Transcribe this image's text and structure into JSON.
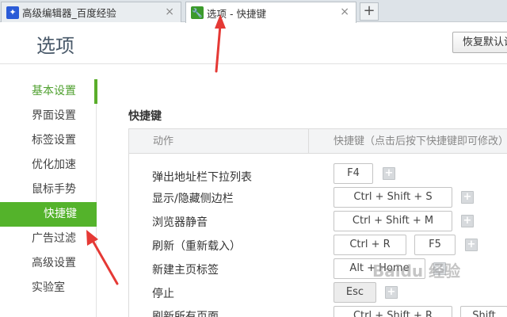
{
  "tabs": [
    {
      "label": "高级编辑器_百度经验",
      "close": "×",
      "icon": "paw-icon"
    },
    {
      "label": "选项 - 快捷键",
      "close": "×",
      "icon": "wrench-icon"
    }
  ],
  "new_tab_label": "+",
  "page": {
    "title": "选项",
    "restore_button": "恢复默认设置"
  },
  "sidebar": [
    {
      "label": "基本设置"
    },
    {
      "label": "界面设置"
    },
    {
      "label": "标签设置"
    },
    {
      "label": "优化加速"
    },
    {
      "label": "鼠标手势"
    },
    {
      "label": "快捷键"
    },
    {
      "label": "广告过滤"
    },
    {
      "label": "高级设置"
    },
    {
      "label": "实验室"
    }
  ],
  "section_title": "快捷键",
  "table": {
    "col_action": "动作",
    "col_shortcut": "快捷键（点击后按下快捷键即可修改）",
    "rows": [
      {
        "action": "弹出地址栏下拉列表",
        "keys": [
          "F4"
        ]
      },
      {
        "action": "显示/隐藏侧边栏",
        "keys": [
          "Ctrl  +  Shift  +  S"
        ]
      },
      {
        "action": "浏览器静音",
        "keys": [
          "Ctrl  +  Shift  +  M"
        ]
      },
      {
        "action": "刷新（重新载入）",
        "keys": [
          "Ctrl  +  R",
          "F5"
        ]
      },
      {
        "action": "新建主页标签",
        "keys": [
          "Alt  +  Home"
        ]
      },
      {
        "action": "停止",
        "keys": [
          "Esc"
        ]
      },
      {
        "action": "刷新所有页面",
        "keys": [
          "Ctrl  +  Shift  +  R",
          "Shift"
        ]
      }
    ],
    "plus_label": "+"
  },
  "watermark": "Baidu 经验",
  "colors": {
    "accent_green": "#54b32b",
    "arrow_red": "#e53935"
  }
}
